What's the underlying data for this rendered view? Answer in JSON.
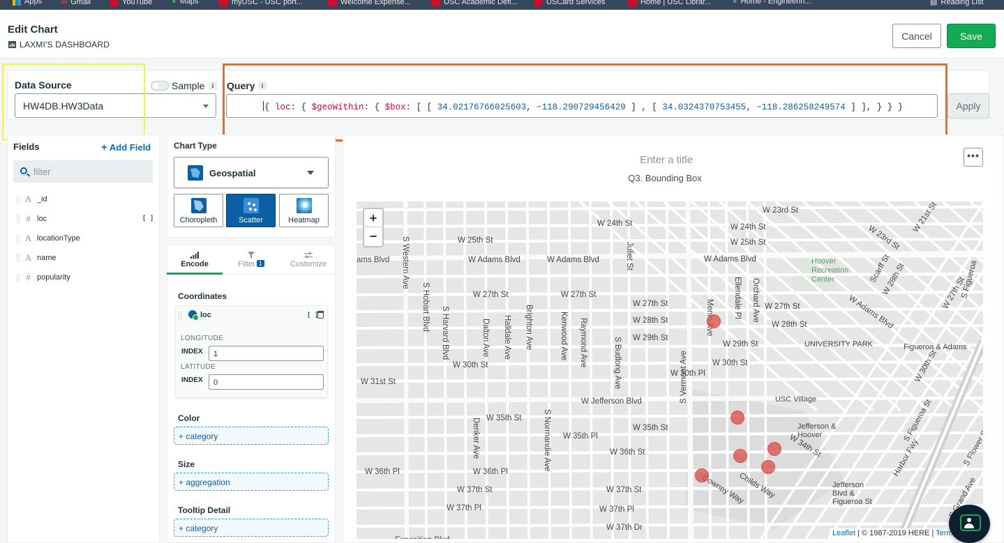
{
  "bookmarks": [
    {
      "label": "Apps",
      "icon": "apps-icon"
    },
    {
      "label": "Gmail",
      "icon": "gmail-icon"
    },
    {
      "label": "YouTube",
      "icon": "youtube-icon"
    },
    {
      "label": "Maps",
      "icon": "maps-icon"
    },
    {
      "label": "myUSC - USC port...",
      "icon": "usc-icon"
    },
    {
      "label": "Welcome Expense...",
      "icon": "usc-icon"
    },
    {
      "label": "USC Academic Defi...",
      "icon": "usc-icon"
    },
    {
      "label": "USCard Services",
      "icon": "usc-icon"
    },
    {
      "label": "Home | USC Librar...",
      "icon": "usc-icon"
    },
    {
      "label": "Home - Engineerin...",
      "icon": "globe-icon"
    },
    {
      "label": "Reading List",
      "icon": "reading-list-icon"
    }
  ],
  "header": {
    "title": "Edit Chart",
    "dashboard": "LAXMI'S DASHBOARD",
    "cancel_label": "Cancel",
    "save_label": "Save"
  },
  "source": {
    "label": "Data Source",
    "value": "HW4DB.HW3Data",
    "sample_label": "Sample",
    "info": "i"
  },
  "query": {
    "label": "Query",
    "info": "i",
    "tokens": {
      "open": "{ ",
      "key1": "loc",
      "p1": ": { ",
      "key2": "$geoWithin",
      "p2": ": { ",
      "key3": "$box",
      "p3": ": [ [ ",
      "n1": "34.02176766025603",
      "p4": ", ",
      "n2": "−118.290729456429",
      "p5": " ] , [ ",
      "n3": "34.0324370753455",
      "p6": ", ",
      "n4": "−118.286258249574",
      "close": " ] ], } } }"
    },
    "apply_label": "Apply"
  },
  "fields": {
    "title": "Fields",
    "add_label": "Add Field",
    "add_plus": "+",
    "filter_placeholder": "filter",
    "items": [
      {
        "type": "A",
        "name": "_id"
      },
      {
        "type": "#",
        "name": "loc"
      },
      {
        "type": "A",
        "name": "locationType"
      },
      {
        "type": "A",
        "name": "name"
      },
      {
        "type": "#",
        "name": "popularity"
      }
    ],
    "array_marker": "[ ]"
  },
  "chart_type": {
    "label": "Chart Type",
    "selected": "Geospatial",
    "options": [
      "Choropleth",
      "Scatter",
      "Heatmap"
    ],
    "active": "Scatter"
  },
  "encode": {
    "tabs": [
      {
        "label": "Encode"
      },
      {
        "label": "Filter",
        "badge": "1"
      },
      {
        "label": "Customize"
      }
    ],
    "coordinates": {
      "title": "Coordinates",
      "field": "loc",
      "array_marker": "[ ]",
      "longitude_label": "LONGITUDE",
      "latitude_label": "LATITUDE",
      "index_label": "INDEX",
      "longitude_index": "1",
      "latitude_index": "0"
    },
    "color": {
      "title": "Color",
      "drop": "+ category"
    },
    "size": {
      "title": "Size",
      "drop": "+ aggregation"
    },
    "tooltip": {
      "title": "Tooltip Detail",
      "drop": "+ category"
    }
  },
  "chart": {
    "title_placeholder": "Enter a title",
    "subtitle": "Q3. Bounding Box",
    "menu_label": "•••",
    "zoom_in": "+",
    "zoom_out": "−",
    "attribution_link": "Leaflet",
    "attribution_text": " | © 1987-2019 HERE | ",
    "attribution_terms": "Term",
    "marker_color": "#d9534f"
  },
  "map_labels": [
    "W 23rd St",
    "W 24th St",
    "W 24th St",
    "W 25th St",
    "W 25th St",
    "ams Blvd",
    "W Adams Blvd",
    "W Adams Blvd",
    "W Adams Blvd",
    "W 27th St",
    "W 27th St",
    "W 27th St",
    "W 27th St",
    "W 28th St",
    "W 28th St",
    "W 29th St",
    "W 29th St",
    "W 30th St",
    "W 30th St",
    "W 30th Pl",
    "W 31st St",
    "W Jefferson Blvd",
    "W 35th St",
    "W 35th St",
    "W 35th Pl",
    "W 36th St",
    "W 36th Pl",
    "W 36th Pl",
    "W 37th St",
    "W 37th St",
    "W 37th Pl",
    "W 37th Pl",
    "W 37th Dr",
    "W 34th St",
    "S Western Ave",
    "S Hobart Blvd",
    "S Harvard Blvd",
    "Dalton Ave",
    "Halldale Ave",
    "Brighton Ave",
    "Kenwood Ave",
    "Raymond Ave",
    "S Budlong Ave",
    "Juliet St",
    "Menlo Ave",
    "Ellendale Pl",
    "Orchard Ave",
    "S Normandie Ave",
    "Denker Ave",
    "S Vermont Ave",
    "Hoover Recreation Center",
    "UNIVERSITY PARK",
    "USC Village",
    "Jefferson & Hoover",
    "Jefferson Blvd & Figueroa St",
    "Figueroa & Adams",
    "Harbor Fwy",
    "S Figueroa St",
    "W 23rd St",
    "W 21st St",
    "S Grand Ave",
    "Childs Way",
    "Downey Way",
    "W Adams Blvd",
    "W 30th St",
    "W 27th St",
    "W 28th St",
    "Scarff St",
    "S Figueroa",
    "Exposition Blvd",
    "S Flower St"
  ]
}
